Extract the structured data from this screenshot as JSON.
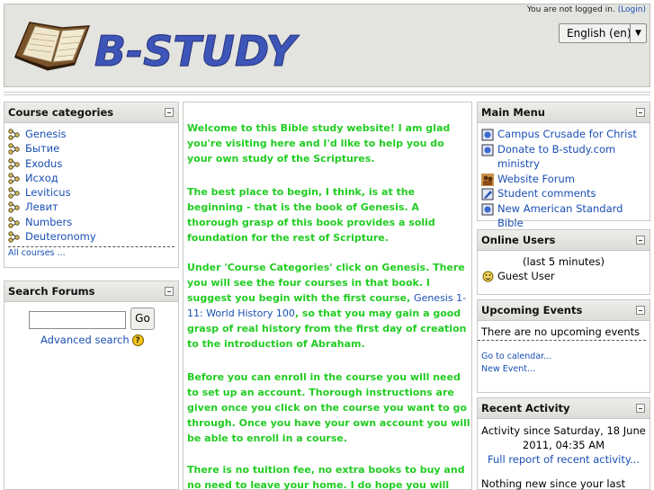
{
  "header": {
    "logo_text": "B-STUDY",
    "login_status": "You are not logged in.",
    "login_link": "(Login)",
    "language": "English (en)"
  },
  "course_categories": {
    "title": "Course categories",
    "items": [
      "Genesis",
      "Бытие",
      "Exodus",
      "Исход",
      "Leviticus",
      "Левит",
      "Numbers",
      "Deuteronomy"
    ],
    "all_courses": "All courses ..."
  },
  "search_forums": {
    "title": "Search Forums",
    "input_value": "",
    "go_label": "Go",
    "advanced_label": "Advanced search",
    "help_symbol": "?"
  },
  "main": {
    "p1": "Welcome to this Bible study website! I am glad you're visiting here and I'd like to help you do your own study of the Scriptures.",
    "p2": "The best place to begin, I think, is at the beginning - that is the book of Genesis. A thorough grasp of this book provides a solid foundation for the rest of Scripture.",
    "p3_before": "Under 'Course Categories' click on Genesis. There you will see the four courses in that book. I suggest you begin with the first course, ",
    "p3_link": "Genesis 1-11: World History 100",
    "p3_after": ", so that you may gain a good grasp of real history from the first day of creation to the introduction of Abraham.",
    "p4": "Before you can enroll in the course you will need to set up an account. Thorough instructions are given once you click on the course you want to go through. Once you have your own account you will be able to enroll in a course.",
    "p5": "There is no tuition fee, no extra books to buy and no need to leave your home. I do hope you will join us for"
  },
  "main_menu": {
    "title": "Main Menu",
    "items": [
      {
        "label": "Campus Crusade for Christ",
        "icon": "page-icon"
      },
      {
        "label": "Donate to B-study.com ministry",
        "icon": "page-icon"
      },
      {
        "label": "Website Forum",
        "icon": "forum-icon"
      },
      {
        "label": "Student comments",
        "icon": "edit-page-icon"
      },
      {
        "label": "New American Standard Bible",
        "icon": "page-icon"
      }
    ]
  },
  "online_users": {
    "title": "Online Users",
    "period": "(last 5 minutes)",
    "users": [
      "Guest User"
    ]
  },
  "upcoming_events": {
    "title": "Upcoming Events",
    "none_text": "There are no upcoming events",
    "goto_calendar": "Go to calendar...",
    "new_event": "New Event..."
  },
  "recent_activity": {
    "title": "Recent Activity",
    "since": "Activity since Saturday, 18 June 2011, 04:35 AM",
    "full_report": "Full report of recent activity...",
    "nothing_new": "Nothing new since your last login"
  },
  "colors": {
    "header_bg": "#e3e3e0",
    "link": "#1a4fb4",
    "main_text": "#22cc22",
    "logo_text": "#3d55b8"
  }
}
